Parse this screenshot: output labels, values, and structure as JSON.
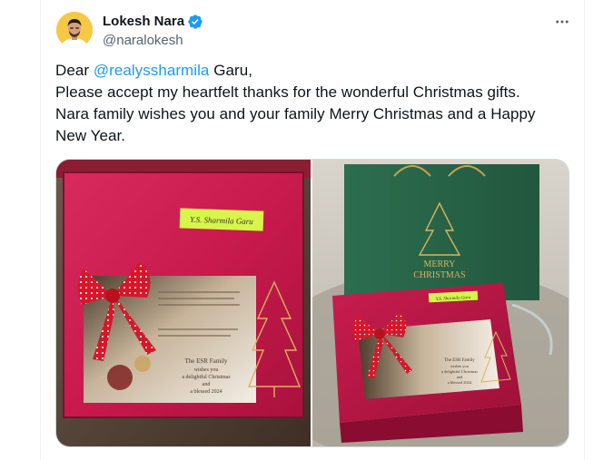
{
  "author": {
    "name": "Lokesh Nara",
    "handle": "@naralokesh",
    "verified": true,
    "avatar_icon": "user-avatar"
  },
  "menu_icon": "more-horizontal-icon",
  "post": {
    "line1_prefix": "Dear ",
    "mention": "@realyssharmila",
    "line1_suffix": " Garu,",
    "line2": "Please accept my heartfelt thanks for the wonderful Christmas gifts.",
    "line3": "Nara family wishes you and your family Merry Christmas and a Happy New Year."
  },
  "media": {
    "photo1": {
      "note_label": "Y.S. Sharmila Garu",
      "card_line1": "The ESR Family",
      "card_line2": "wishes you",
      "card_line3": "a delightful Christmas",
      "card_line4": "and",
      "card_line5": "a blessed 2024"
    },
    "photo2": {
      "bag_text_top": "MERRY",
      "bag_text_bottom": "CHRISTMAS",
      "note_label": "Y.S. Sharmila Garu",
      "card_line1": "The ESR Family",
      "card_line2": "wishes you",
      "card_line3": "a delightful Christmas",
      "card_line4": "and",
      "card_line5": "a blessed 2024"
    }
  },
  "colors": {
    "accent": "#1d9bf0",
    "secondary_text": "#536471",
    "box_red": "#c8184a",
    "bag_green": "#2f6b4e"
  }
}
